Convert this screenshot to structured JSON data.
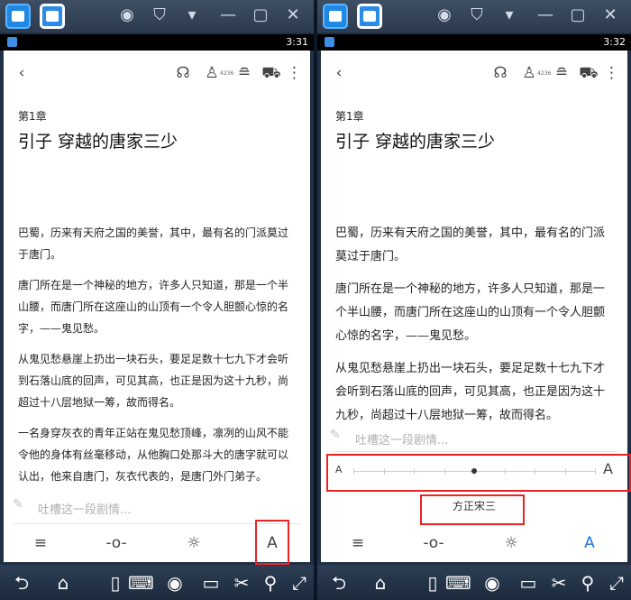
{
  "window": {
    "title_icons": [
      "home-tab-icon",
      "reader-app-tab-icon"
    ],
    "controls": [
      "account-icon",
      "shirt-icon",
      "minimize-dropdown-icon",
      "minimize-icon",
      "maximize-icon",
      "close-icon"
    ]
  },
  "panels": [
    {
      "status_time": "3:31",
      "listen_count": "4236",
      "chapter": "第1章",
      "title": "引子 穿越的唐家三少",
      "paragraphs": [
        "巴蜀，历来有天府之国的美誉，其中，最有名的门派莫过于唐门。",
        "唐门所在是一个神秘的地方，许多人只知道，那是一个半山腰，而唐门所在这座山的山顶有一个令人胆颤心惊的名字，——鬼见愁。",
        "从鬼见愁悬崖上扔出一块石头，要足足数十七九下才会听到石落山底的回声，可见其高，也正是因为这十九秒，尚超过十八层地狱一筹，故而得名。",
        "一名身穿灰衣的青年正站在鬼见愁顶峰，凛冽的山风不能令他的身体有丝毫移动，从他胸口处那斗大的唐字就可以认出，他来自唐门，灰衣代表的，是唐门外门弟子。"
      ],
      "comment_placeholder": "吐槽这一段剧情...",
      "font_button": "A"
    },
    {
      "status_time": "3:32",
      "listen_count": "4236",
      "chapter": "第1章",
      "title": "引子 穿越的唐家三少",
      "paragraphs": [
        "巴蜀，历来有天府之国的美誉，其中，最有名的门派莫过于唐门。",
        "唐门所在是一个神秘的地方，许多人只知道，那是一个半山腰，而唐门所在这座山的山顶有一个令人胆颤心惊的名字，——鬼见愁。",
        "从鬼见愁悬崖上扔出一块石头，要足足数十七九下才会听到石落山底的回声，可见其高，也正是因为这十九秒，尚超过十八层地狱一筹，故而得名。"
      ],
      "comment_placeholder": "吐槽这一段剧情...",
      "font_size_small": "A",
      "font_size_large": "A",
      "font_name": "方正宋三",
      "font_button": "A",
      "font_size_level": 0.5
    }
  ]
}
